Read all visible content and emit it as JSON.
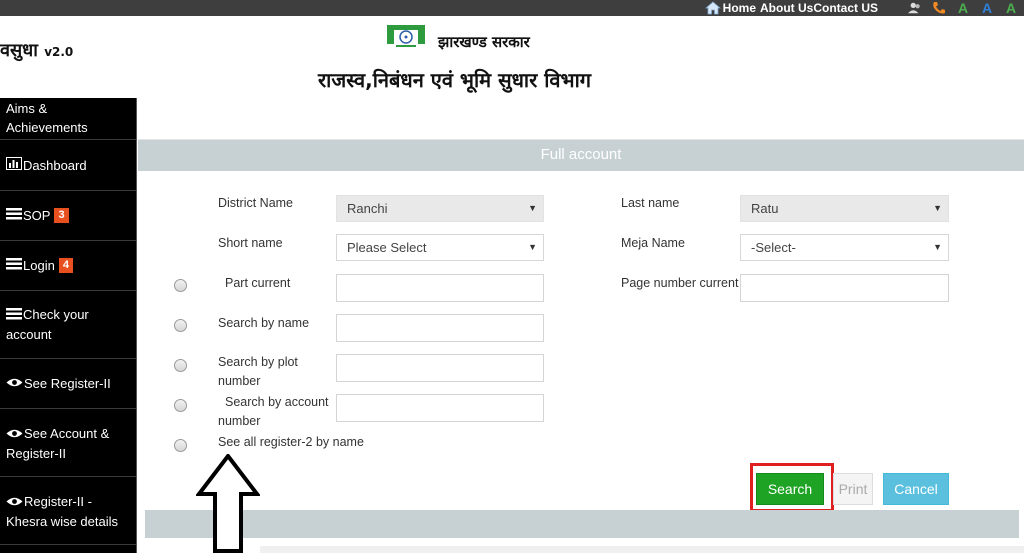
{
  "topbar": {
    "home": "Home",
    "about": "About Us",
    "contact": "Contact US",
    "icons": [
      "users-icon",
      "phone-icon",
      "font-increase-icon",
      "font-normal-icon",
      "font-decrease-icon"
    ],
    "font_glyph": "A"
  },
  "header": {
    "brand": "वसुधा",
    "version": "v2.0",
    "emblem_text": "झारखण्ड सरकार",
    "gov_name": "झारखण्ड सरकार",
    "department": "राजस्व,निबंधन एवं भूमि सुधार  विभाग"
  },
  "sidebar": {
    "items": [
      {
        "label": "Aims & Achievements"
      },
      {
        "label": "Dashboard"
      },
      {
        "label": "SOP",
        "badge": "3"
      },
      {
        "label": "Login",
        "badge": "4"
      },
      {
        "label": "Check your account"
      },
      {
        "label": "See Register-II"
      },
      {
        "label": "See Account & Register-II"
      },
      {
        "label": "Register-II - Khesra wise details"
      }
    ]
  },
  "panel": {
    "title": "Full account"
  },
  "form": {
    "district_label": "District Name",
    "district_value": "Ranchi",
    "last_name_label": "Last name",
    "last_name_value": "Ratu",
    "short_name_label": "Short name",
    "short_name_value": "Please Select",
    "meja_label": "Meja Name",
    "meja_value": "-Select-",
    "part_current_label": "Part current",
    "page_number_label": "Page number current",
    "search_name_label": "Search by name",
    "search_plot_label": "Search by plot number",
    "search_account_label": "Search by account number",
    "see_all_label": "See all register-2 by name"
  },
  "buttons": {
    "search": "Search",
    "print": "Print",
    "cancel": "Cancel"
  },
  "colors": {
    "accent_green": "#1ea324",
    "highlight_red": "#e02020",
    "badge_orange": "#e8501f",
    "panel_gray": "#c7d1d3",
    "cancel_blue": "#5bc0de"
  }
}
